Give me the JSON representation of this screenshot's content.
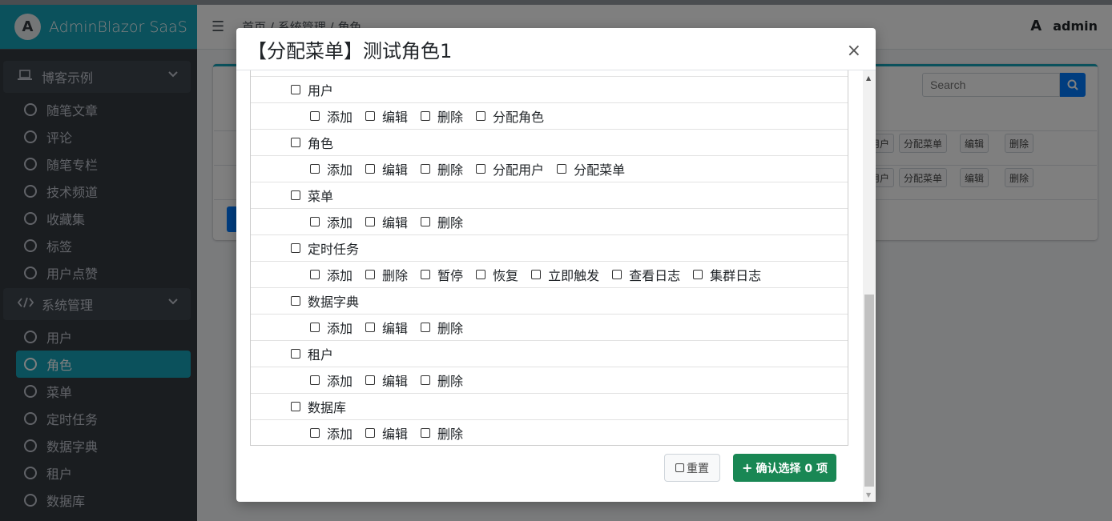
{
  "app": {
    "title": "AdminBlazor SaaS",
    "logo_letter": "A",
    "user_name": "admin"
  },
  "breadcrumb": "首页 / 系统管理 / 角色",
  "sidebar": {
    "groups": [
      {
        "label": "博客示例",
        "icon": "laptop-icon",
        "items": [
          "随笔文章",
          "评论",
          "随笔专栏",
          "技术频道",
          "收藏集",
          "标签",
          "用户点赞"
        ]
      },
      {
        "label": "系统管理",
        "icon": "code-icon",
        "items": [
          "用户",
          "角色",
          "菜单",
          "定时任务",
          "数据字典",
          "租户",
          "数据库"
        ]
      }
    ],
    "active_item": "角色"
  },
  "background_table": {
    "search_placeholder": "Search",
    "row_buttons": [
      "用户",
      "分配菜单",
      "编辑",
      "删除"
    ]
  },
  "modal": {
    "title": "【分配菜单】测试角色1",
    "close_symbol": "×",
    "tree": [
      {
        "label": "用户",
        "children": [
          "添加",
          "编辑",
          "删除",
          "分配角色"
        ]
      },
      {
        "label": "角色",
        "children": [
          "添加",
          "编辑",
          "删除",
          "分配用户",
          "分配菜单"
        ]
      },
      {
        "label": "菜单",
        "children": [
          "添加",
          "编辑",
          "删除"
        ]
      },
      {
        "label": "定时任务",
        "children": [
          "添加",
          "删除",
          "暂停",
          "恢复",
          "立即触发",
          "查看日志",
          "集群日志"
        ]
      },
      {
        "label": "数据字典",
        "children": [
          "添加",
          "编辑",
          "删除"
        ]
      },
      {
        "label": "租户",
        "children": [
          "添加",
          "编辑",
          "删除"
        ]
      },
      {
        "label": "数据库",
        "children": [
          "添加",
          "编辑",
          "删除"
        ]
      }
    ],
    "reset_label": "重置",
    "confirm_label": "确认选择 0 项"
  },
  "colors": {
    "brand": "#17a2b8",
    "sidebar_bg": "#343a40",
    "confirm": "#198754",
    "search_btn": "#007bff"
  }
}
